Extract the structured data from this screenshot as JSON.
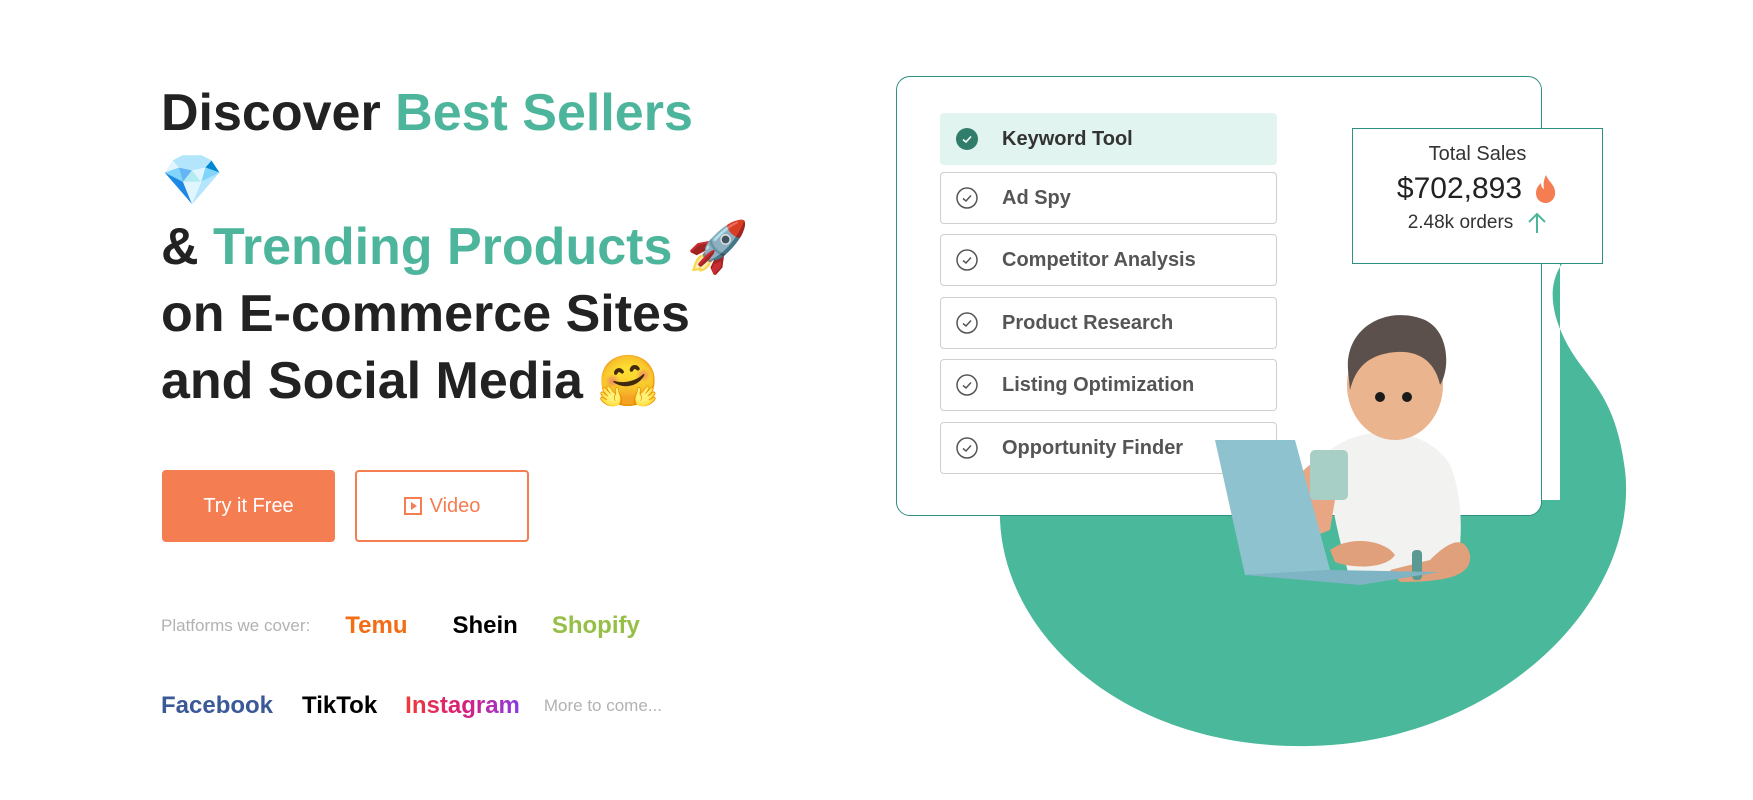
{
  "hero": {
    "line1_prefix": "Discover ",
    "line1_accent": "Best Sellers",
    "line2_emoji": "💎",
    "line3_prefix": "& ",
    "line3_accent": "Trending Products",
    "line3_emoji": "🚀",
    "line4": "on E-commerce Sites",
    "line5": "and Social Media ",
    "line5_emoji": "🤗"
  },
  "buttons": {
    "try_free": "Try it Free",
    "video": "Video",
    "video_icon": "play-square-icon"
  },
  "platforms": {
    "label": "Platforms we cover:",
    "items": [
      {
        "name": "Temu",
        "color": "#f26d16"
      },
      {
        "name": "Shein",
        "color": "#000000"
      },
      {
        "name": "Shopify",
        "color": "#95bf47"
      },
      {
        "name": "Facebook",
        "color": "#3b5998"
      },
      {
        "name": "TikTok",
        "color": "#000000"
      },
      {
        "name": "Instagram",
        "color": "#e1306c"
      }
    ],
    "more": "More to come..."
  },
  "tools": {
    "items": [
      {
        "label": "Keyword Tool",
        "active": true
      },
      {
        "label": "Ad Spy",
        "active": false
      },
      {
        "label": "Competitor Analysis",
        "active": false
      },
      {
        "label": "Product Research",
        "active": false
      },
      {
        "label": "Listing Optimization",
        "active": false
      },
      {
        "label": "Opportunity Finder",
        "active": false
      }
    ]
  },
  "stats": {
    "title": "Total Sales",
    "value": "$702,893",
    "value_icon": "fire-icon",
    "orders": "2.48k orders",
    "orders_icon": "arrow-up-icon"
  },
  "colors": {
    "accent": "#4cb59b",
    "primary_button": "#f47d52",
    "card_border": "#2f8f80",
    "active_item_bg": "#e2f4ef",
    "check_fill": "#2f7d6a"
  }
}
